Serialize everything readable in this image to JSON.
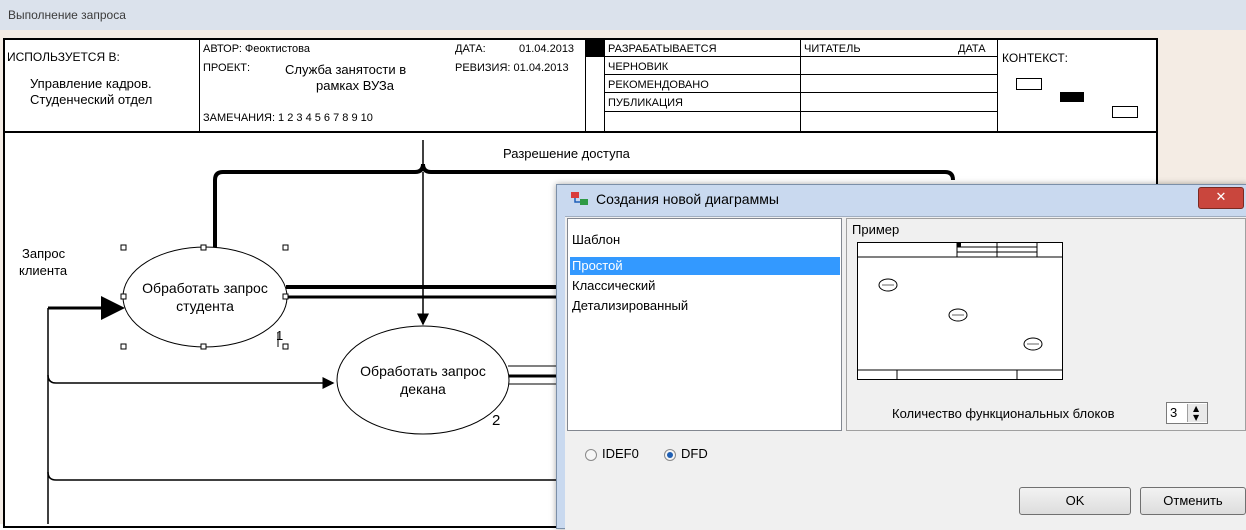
{
  "window": {
    "title": "Выполнение запроса"
  },
  "header": {
    "used_in_label": "ИСПОЛЬЗУЕТСЯ В:",
    "used_in_line1": "Управление кадров.",
    "used_in_line2": "Студенческий отдел",
    "author_label": "АВТОР: Феоктистова",
    "date_label": "ДАТА:",
    "date_value": "01.04.2013",
    "project_label": "ПРОЕКТ:",
    "project_line1": "Служба занятости в",
    "project_line2": "рамках ВУЗа",
    "revision_label": "РЕВИЗИЯ: 01.04.2013",
    "notes_label": "ЗАМЕЧАНИЯ:  1  2  3  4  5  6  7  8  9  10",
    "status_working": "РАЗРАБАТЫВАЕТСЯ",
    "status_draft": "ЧЕРНОВИК",
    "status_recommended": "РЕКОМЕНДОВАНО",
    "status_publication": "ПУБЛИКАЦИЯ",
    "reader_label": "ЧИТАТЕЛЬ",
    "reader_date_label": "ДАТА",
    "context_label": "КОНТЕКСТ:"
  },
  "diagram": {
    "access_label": "Разрешение доступа",
    "request_label_line1": "Запрос",
    "request_label_line2": "клиента",
    "process1_line1": "Обработать запрос",
    "process1_line2": "студента",
    "process1_number": "1",
    "process2_line1": "Обработать запрос",
    "process2_line2": "декана",
    "process2_number": "2"
  },
  "dialog": {
    "title": "Создания новой диаграммы",
    "template_header": "Шаблон",
    "templates": [
      "Простой",
      "Классический",
      "Детализированный"
    ],
    "selected_template": "Простой",
    "preview_label": "Пример",
    "blocks_label": "Количество функциональных блоков",
    "blocks_value": "3",
    "method_idef0": "IDEF0",
    "method_dfd": "DFD",
    "selected_method": "DFD",
    "ok_label": "OK",
    "cancel_label": "Отменить",
    "close_glyph": "✕"
  },
  "colors": {
    "selection": "#3399ff",
    "close_button": "#c9463d",
    "titlebar": "#dbe2ec"
  }
}
